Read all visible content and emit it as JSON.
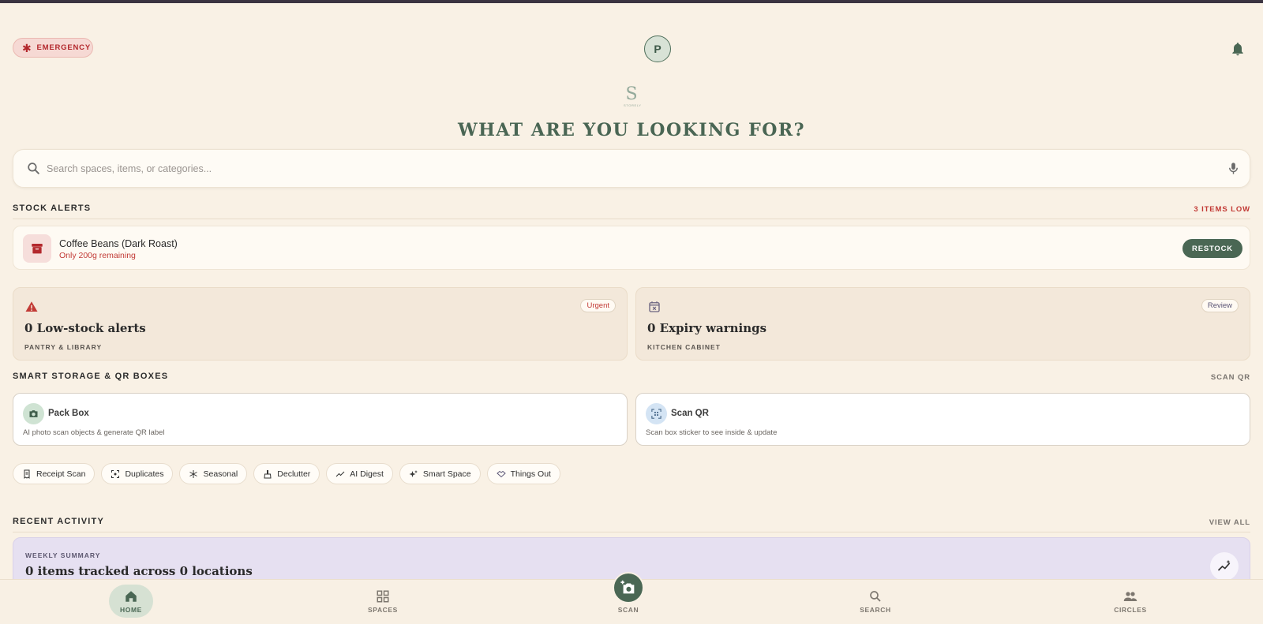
{
  "header": {
    "emergency_label": "EMERGENCY",
    "avatar_initial": "P"
  },
  "brand": {
    "logo_letter": "S",
    "logo_sub": "STORELY"
  },
  "hero": {
    "title": "WHAT ARE YOU LOOKING FOR?"
  },
  "search": {
    "placeholder": "Search spaces, items, or categories..."
  },
  "stock_alerts": {
    "title": "STOCK ALERTS",
    "count_label": "3 ITEMS LOW",
    "item": {
      "name": "Coffee Beans (Dark Roast)",
      "detail": "Only 200g remaining",
      "action": "RESTOCK"
    }
  },
  "stats": [
    {
      "value_label": "0 Low-stock alerts",
      "location": "PANTRY & LIBRARY",
      "badge": "Urgent",
      "badge_color": "#c23a35"
    },
    {
      "value_label": "0 Expiry warnings",
      "location": "KITCHEN CABINET",
      "badge": "Review",
      "badge_color": "#5b5676"
    }
  ],
  "smart_storage": {
    "title": "SMART STORAGE & QR BOXES",
    "link": "SCAN QR",
    "cards": [
      {
        "title": "Pack Box",
        "subtitle": "AI photo scan objects & generate QR label"
      },
      {
        "title": "Scan QR",
        "subtitle": "Scan box sticker to see inside & update"
      }
    ]
  },
  "chips": [
    "Receipt Scan",
    "Duplicates",
    "Seasonal",
    "Declutter",
    "AI Digest",
    "Smart Space",
    "Things Out"
  ],
  "recent_activity": {
    "title": "RECENT ACTIVITY",
    "link": "VIEW ALL",
    "weekly_caption": "WEEKLY SUMMARY",
    "weekly_text": "0 items tracked across 0 locations"
  },
  "bottom_nav": {
    "home": "HOME",
    "spaces": "SPACES",
    "scan": "SCAN",
    "search": "SEARCH",
    "circles": "CIRCLES"
  },
  "colors": {
    "accent": "#4a6754",
    "background": "#f9f1e5",
    "danger": "#c23a35"
  }
}
